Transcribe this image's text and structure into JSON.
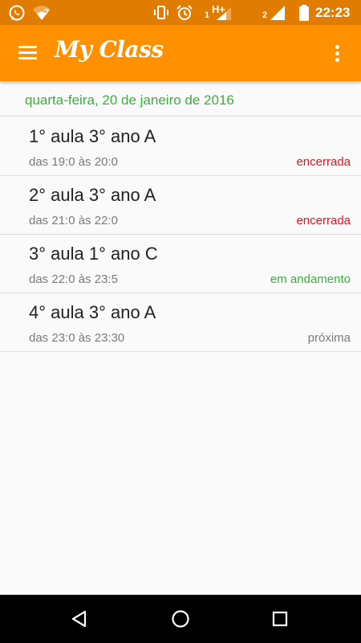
{
  "status_bar": {
    "time": "22:23",
    "network_type": "H+",
    "sim1": "1",
    "sim2": "2",
    "wifi_question": "?",
    "bg_color": "#e07c00",
    "icons": [
      "whatsapp-icon",
      "wifi-question-icon",
      "vibrate-icon",
      "alarm-icon",
      "signal-sim1-icon",
      "signal-sim2-icon",
      "battery-icon"
    ]
  },
  "app_bar": {
    "title": "My Class",
    "color": "#ff9100",
    "icons": [
      "menu-icon",
      "more-vert-icon"
    ]
  },
  "date_header": "quarta-feira, 20 de janeiro de 2016",
  "lessons": [
    {
      "title": "1° aula 3° ano A",
      "time": "das 19:0 às 20:0",
      "status": "encerrada",
      "status_color": "#e0141e"
    },
    {
      "title": "2° aula 3° ano A",
      "time": "das 21:0 às 22:0",
      "status": "encerrada",
      "status_color": "#e0141e"
    },
    {
      "title": "3° aula 1° ano C",
      "time": "das 22:0 às 23:5",
      "status": "em andamento",
      "status_color": "#3cae3c"
    },
    {
      "title": "4° aula 3° ano A",
      "time": "das 23:0 às 23:30",
      "status": "próxima",
      "status_color": "#7a7a7a"
    }
  ],
  "nav_bar": {
    "icons": [
      "back-icon",
      "home-icon",
      "recents-icon"
    ]
  }
}
